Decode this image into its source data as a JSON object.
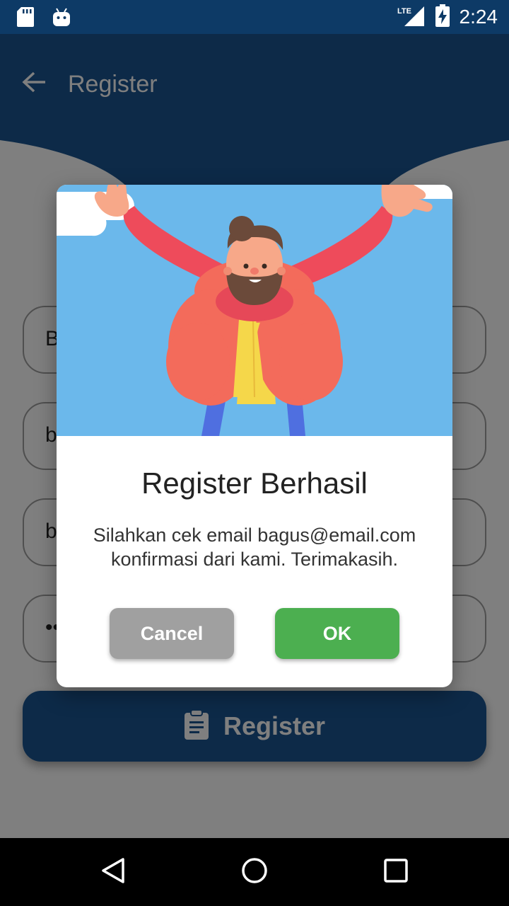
{
  "status_bar": {
    "time": "2:24",
    "network_label": "LTE",
    "icons": [
      "sd-card-icon",
      "android-debug-icon",
      "lte-signal-icon",
      "battery-charging-icon"
    ]
  },
  "app_bar": {
    "title": "Register",
    "back_icon": "arrow-back-icon",
    "color": "#1a5590"
  },
  "form": {
    "fields": [
      {
        "value": "B"
      },
      {
        "value": "b"
      },
      {
        "value": "b"
      },
      {
        "value": "••"
      }
    ],
    "register_button": {
      "label": "Register",
      "icon": "clipboard-icon"
    }
  },
  "dialog": {
    "illustration": "celebrating-bearded-man",
    "title": "Register Berhasil",
    "message_line1": "Silahkan cek email bagus@email.com",
    "message_line2": "konfirmasi dari kami. Terimakasih.",
    "cancel_label": "Cancel",
    "ok_label": "OK",
    "cancel_color": "#a0a0a0",
    "ok_color": "#4caf50"
  },
  "nav_bar": {
    "icons": [
      "back-triangle-icon",
      "home-circle-icon",
      "recents-square-icon"
    ]
  }
}
